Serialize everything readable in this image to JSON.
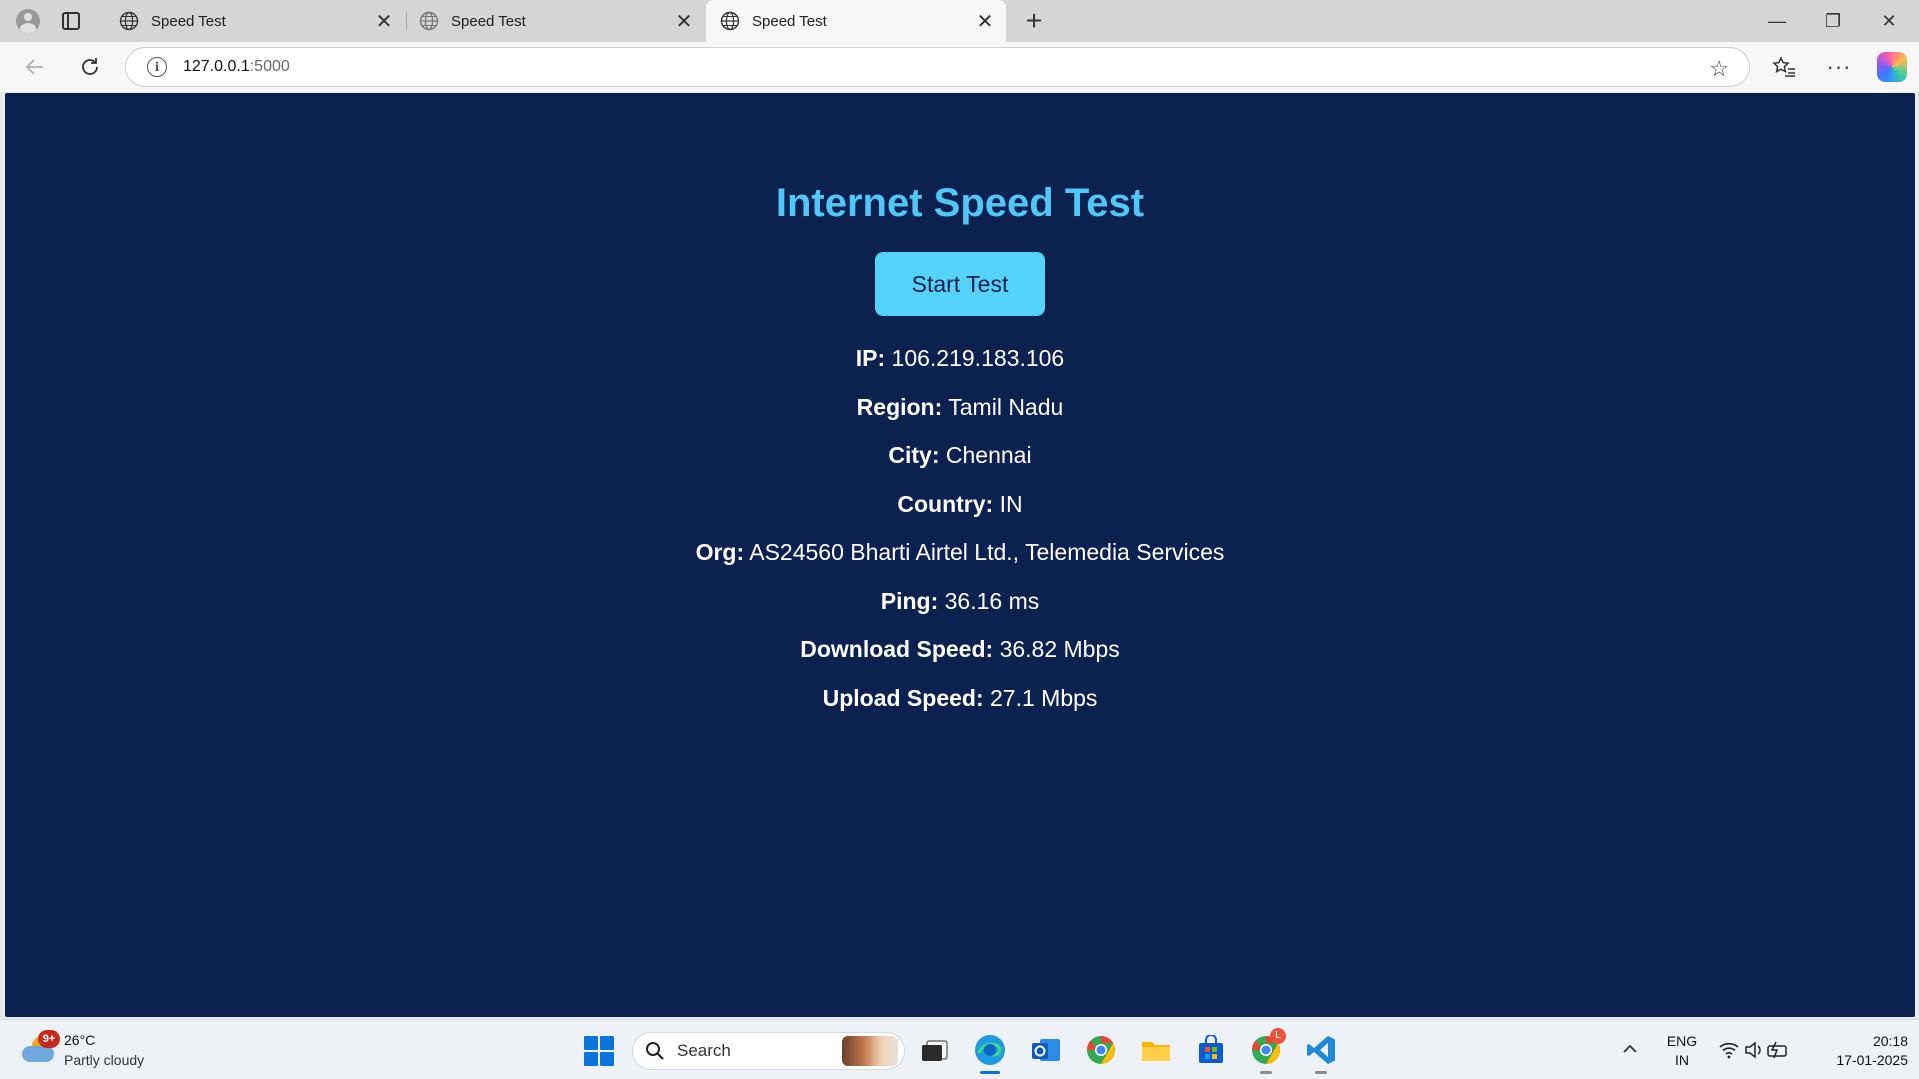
{
  "browser": {
    "tabs": [
      {
        "title": "Speed Test",
        "active": false
      },
      {
        "title": "Speed Test",
        "active": false
      },
      {
        "title": "Speed Test",
        "active": true
      }
    ],
    "address": {
      "host": "127.0.0.1",
      "port": ":5000"
    }
  },
  "page": {
    "title": "Internet Speed Test",
    "start_button": "Start Test",
    "info": [
      {
        "label": "IP:",
        "value": "106.219.183.106"
      },
      {
        "label": "Region:",
        "value": "Tamil Nadu"
      },
      {
        "label": "City:",
        "value": "Chennai"
      },
      {
        "label": "Country:",
        "value": "IN"
      },
      {
        "label": "Org:",
        "value": "AS24560 Bharti Airtel Ltd., Telemedia Services"
      },
      {
        "label": "Ping:",
        "value": "36.16 ms"
      },
      {
        "label": "Download Speed:",
        "value": "36.82 Mbps"
      },
      {
        "label": "Upload Speed:",
        "value": "27.1 Mbps"
      }
    ]
  },
  "taskbar": {
    "weather": {
      "badge": "9+",
      "temp": "26°C",
      "condition": "Partly cloudy"
    },
    "search_label": "Search",
    "apps": [
      "task-view",
      "edge",
      "outlook",
      "chrome",
      "file-explorer",
      "microsoft-store",
      "chrome-profile",
      "vscode"
    ],
    "chrome_profile_badge": "L",
    "language": {
      "line1": "ENG",
      "line2": "IN"
    },
    "clock": {
      "time": "20:18",
      "date": "17-01-2025"
    }
  },
  "colors": {
    "page_background": "#0b2150",
    "title_color": "#50c8f5",
    "button_color": "#55d2f7",
    "text_color": "#ffffff"
  }
}
